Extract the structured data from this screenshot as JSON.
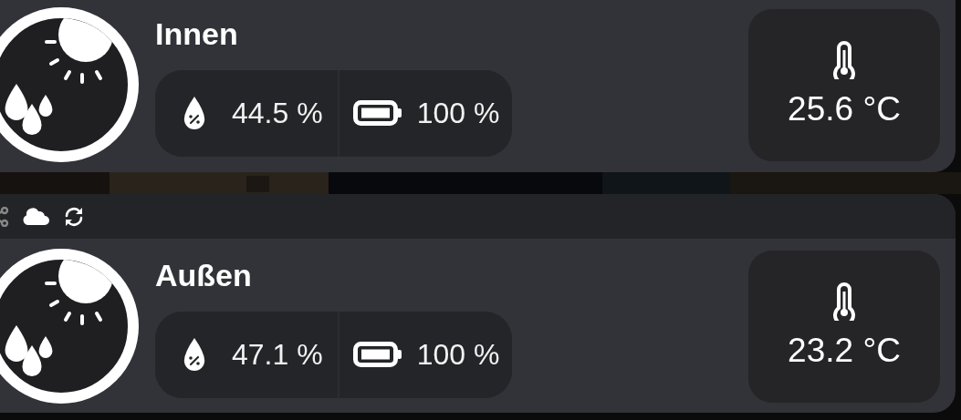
{
  "cards": [
    {
      "name": "Innen",
      "humidity": "44.5 %",
      "battery": "100 %",
      "temperature": "25.6 °C",
      "toolbar": false
    },
    {
      "name": "Außen",
      "humidity": "47.1 %",
      "battery": "100 %",
      "temperature": "23.2 °C",
      "toolbar": true
    }
  ]
}
